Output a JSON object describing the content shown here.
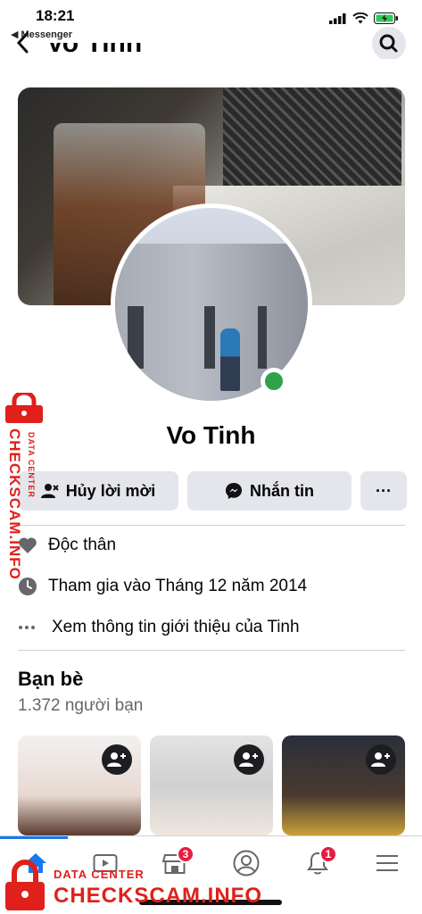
{
  "status_bar": {
    "time": "18:21",
    "back_app": "◀ Messenger"
  },
  "header": {
    "title": "Vo Tinh"
  },
  "profile": {
    "name": "Vo Tinh",
    "online": true
  },
  "actions": {
    "cancel_request": "Hủy lời mời",
    "message": "Nhắn tin",
    "more": "···"
  },
  "info": {
    "relationship": "Độc thân",
    "joined": "Tham gia vào Tháng 12 năm 2014",
    "see_about": "Xem thông tin giới thiệu của Tinh"
  },
  "friends": {
    "title": "Bạn bè",
    "count": "1.372 người bạn"
  },
  "bottom_nav": {
    "items": [
      "home-icon",
      "video-icon",
      "marketplace-icon",
      "profile-icon",
      "notifications-icon",
      "menu-icon"
    ],
    "marketplace_badge": "3",
    "notifications_badge": "1"
  },
  "watermark": {
    "sub": "DATA CENTER",
    "brand": "CHECKSCAM.INFO"
  },
  "colors": {
    "accent": "#1877f2",
    "online": "#31a24c",
    "badge": "#e41e3f",
    "watermark": "#e0201b"
  }
}
